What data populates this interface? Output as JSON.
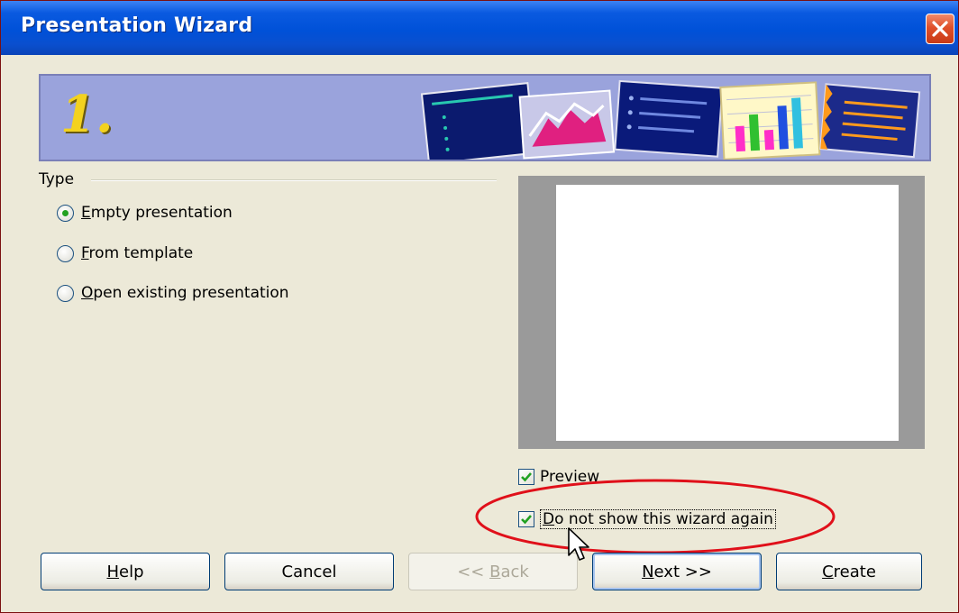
{
  "window": {
    "title": "Presentation Wizard"
  },
  "banner": {
    "step_number": "1.",
    "thumbnails": [
      "outline-slide-thumb",
      "chart-slide-thumb",
      "bullet-slide-thumb",
      "bar-chart-thumb",
      "list-slide-thumb"
    ]
  },
  "type_group": {
    "label": "Type",
    "options": [
      {
        "text": "Empty presentation",
        "mnemonic": "E",
        "rest": "mpty presentation",
        "selected": true
      },
      {
        "text": "From template",
        "mnemonic": "F",
        "rest": "rom template",
        "selected": false
      },
      {
        "text": "Open existing presentation",
        "mnemonic": "O",
        "rest": "pen existing presentation",
        "selected": false
      }
    ]
  },
  "checkboxes": {
    "preview": {
      "label": "Preview",
      "checked": true
    },
    "do_not_show": {
      "label": "Do not show this wizard again",
      "mnemonic": "D",
      "rest": "o not show this wizard again",
      "checked": true
    }
  },
  "buttons": {
    "help": {
      "label": "Help",
      "mnemonic": "H",
      "rest": "elp"
    },
    "cancel": {
      "label": "Cancel"
    },
    "back": {
      "prefix": "<< ",
      "mnemonic": "B",
      "rest": "ack",
      "enabled": false
    },
    "next": {
      "mnemonic": "N",
      "rest": "ext >>",
      "default": true
    },
    "create": {
      "mnemonic": "C",
      "rest": "reate"
    }
  },
  "colors": {
    "titlebar": "#0a54d9",
    "close_button": "#d9481f",
    "dialog_bg": "#ece9d8",
    "annotation": "#e0101a",
    "radio_dot": "#21a121"
  }
}
